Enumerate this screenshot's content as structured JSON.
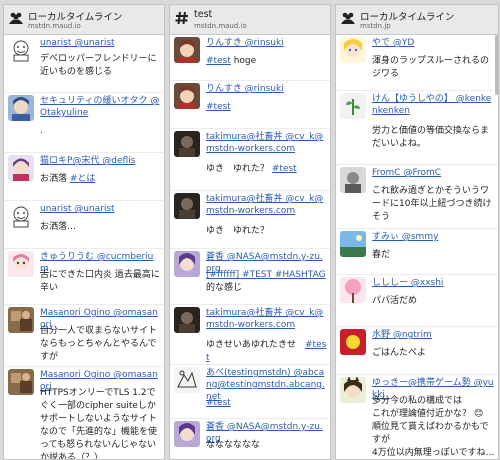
{
  "columns": [
    {
      "title": "ローカルタイムライン",
      "server": "mstdn.maud.io",
      "icon": "people-icon",
      "toots": [
        {
          "name": "unarist @unarist",
          "text": "デベロッパーフレンドリーに近いものを感じる",
          "avatar": "text-face"
        },
        {
          "name": "セキュリティの緩いオタク @Otakyuline",
          "text": ".",
          "avatar": "blue-girl"
        },
        {
          "name": "猫ロキP@宋代 @deflis",
          "text": "お洒落 ",
          "tag": "#とは",
          "avatar": "purple-char"
        },
        {
          "name": "unarist @unarist",
          "text": "お洒落…",
          "avatar": "text-face"
        },
        {
          "name": "きゅうりうむ @cucmberium",
          "text": "舌にできた口内炎 過去最高に辛い",
          "avatar": "pink-girl"
        },
        {
          "name": "Masanori Ogino @omasanori",
          "text": "自分一人で収まらないサイトならもっとちゃんとやるんですが",
          "avatar": "brown-photo"
        },
        {
          "name": "Masanori Ogino @omasanori",
          "text": "HTTPSオンリーでTLS 1.2でぐく一部のcipher suiteしかサポートしないようなサイトなので「先進的な」機能を使っても怒られないんじゃないか説ある（？）",
          "avatar": "brown-photo"
        }
      ]
    },
    {
      "title": "test",
      "server": "mstdn.maud.io",
      "icon": "hashtag-icon",
      "toots": [
        {
          "name": "りんすき @rinsuki",
          "text": "",
          "tag": "#test",
          "after": " hoge",
          "avatar": "brown-anime"
        },
        {
          "name": "りんすき @rinsuki",
          "text": "",
          "tag": "#test",
          "avatar": "brown-anime"
        },
        {
          "name": "takimura@社畜丼 @cv_k@mstdn-workers.com",
          "text": "ゆき　ゆれた？ ",
          "tag": "#test",
          "avatar": "dark-photo"
        },
        {
          "name": "takimura@社畜丼 @cv_k@mstdn-workers.com",
          "text": "ゆき　ゆれた？",
          "avatar": "dark-photo"
        },
        {
          "name": "蒼香 @NASA@mstdn.y-zu.org",
          "text": "",
          "tag": "[#ffffff] #TEST #HASHTAG",
          "after": "\n的な感じ",
          "avatar": "purple-hair"
        },
        {
          "name": "takimura@社畜丼 @cv_k@mstdn-workers.com",
          "text": "ゆきせいあゆれたきせ　",
          "tag": "#test",
          "avatar": "dark-photo"
        },
        {
          "name": "あべ(testingmstdn) @abcang@testingmstdn.abcang.net",
          "text": "",
          "tag": "#test",
          "avatar": "sketch"
        },
        {
          "name": "蒼香 @NASA@mstdn.y-zu.org",
          "text": "なななななな",
          "avatar": "purple-hair"
        }
      ]
    },
    {
      "title": "ローカルタイムライン",
      "server": "mstdn.jp",
      "icon": "people-icon",
      "toots": [
        {
          "name": "やで @YD",
          "text": "渾身のラップスルーされるのジワる",
          "avatar": "blonde-girl"
        },
        {
          "name": "けん【ゆうしやの】 @kenkenkenken",
          "text": "労力と価値の等価交換ならまだいいよね。",
          "avatar": "green-plant"
        },
        {
          "name": "FromC @FromC",
          "text": "これ飲み過ぎとかそういうワードに10年以上紐づつき続けそう",
          "avatar": "gray-person"
        },
        {
          "name": "すみぃ @smmy",
          "text": "春だ",
          "avatar": "blue-sky"
        },
        {
          "name": "しししー @xxshi",
          "text": "パパ活だめ",
          "avatar": "pink-tree"
        },
        {
          "name": "水野 @ngtrim",
          "text": "ごはんたべよ",
          "avatar": "red-yellow"
        },
        {
          "name": "ゆっきー@携帯ゲーム勢 @yukki_",
          "text": "多分今の私の構成では\nこれが理論値付近かな？ 😊\n順位見て貰えばわかるかもですが\n4万位以内無理っぽいですね…",
          "avatar": "girl-bunny"
        }
      ]
    }
  ],
  "colors": {
    "link": "#2a5db0",
    "header_bg": "#e9e9e9",
    "page_bg": "#d9d9d9"
  }
}
